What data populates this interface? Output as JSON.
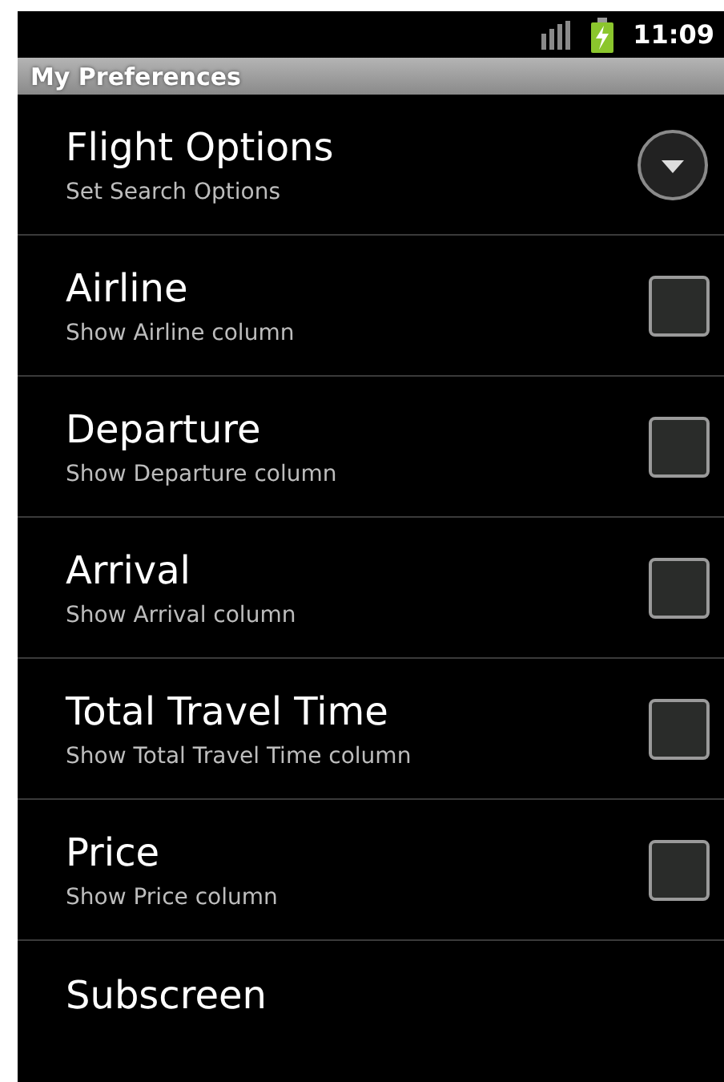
{
  "status_bar": {
    "time": "11:09",
    "battery_charging": true
  },
  "title_bar": {
    "title": "My Preferences"
  },
  "preferences": [
    {
      "kind": "list",
      "title": "Flight Options",
      "summary": "Set Search Options"
    },
    {
      "kind": "checkbox",
      "title": "Airline",
      "summary": "Show Airline column",
      "checked": false
    },
    {
      "kind": "checkbox",
      "title": "Departure",
      "summary": "Show Departure column",
      "checked": false
    },
    {
      "kind": "checkbox",
      "title": "Arrival",
      "summary": "Show Arrival column",
      "checked": false
    },
    {
      "kind": "checkbox",
      "title": "Total Travel Time",
      "summary": "Show Total Travel Time column",
      "checked": false
    },
    {
      "kind": "checkbox",
      "title": "Price",
      "summary": "Show Price column",
      "checked": false
    },
    {
      "kind": "screen",
      "title": "Subscreen"
    }
  ]
}
